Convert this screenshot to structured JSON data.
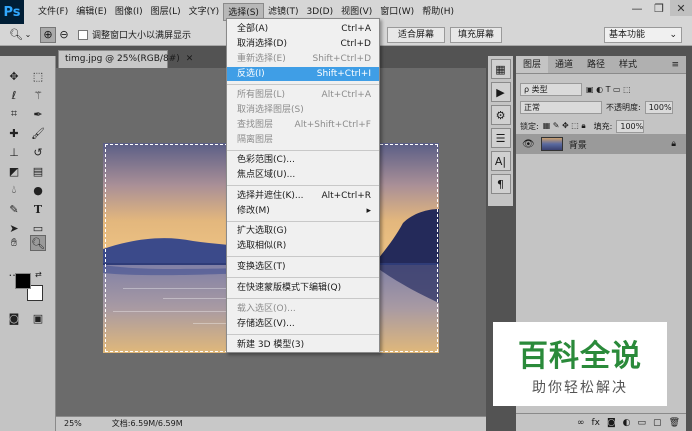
{
  "app_logo": "Ps",
  "menubar": [
    "文件(F)",
    "编辑(E)",
    "图像(I)",
    "图层(L)",
    "文字(Y)",
    "选择(S)",
    "滤镜(T)",
    "3D(D)",
    "视图(V)",
    "窗口(W)",
    "帮助(H)"
  ],
  "options_bar": {
    "checkbox_label": "调整窗口大小以满屏显示",
    "btn_fit": "适合屏幕",
    "btn_fill": "填充屏幕",
    "workspace": "基本功能"
  },
  "document_tab": {
    "title": "timg.jpg @ 25%(RGB/8#)"
  },
  "status_bar": {
    "zoom": "25%",
    "doc": "文档:6.59M/6.59M"
  },
  "select_menu": [
    {
      "label": "全部(A)",
      "shortcut": "Ctrl+A",
      "state": "normal"
    },
    {
      "label": "取消选择(D)",
      "shortcut": "Ctrl+D",
      "state": "normal"
    },
    {
      "label": "重新选择(E)",
      "shortcut": "Shift+Ctrl+D",
      "state": "disabled"
    },
    {
      "label": "反选(I)",
      "shortcut": "Shift+Ctrl+I",
      "state": "highlighted"
    },
    {
      "label": "所有图层(L)",
      "shortcut": "Alt+Ctrl+A",
      "state": "disabled"
    },
    {
      "label": "取消选择图层(S)",
      "shortcut": "",
      "state": "disabled"
    },
    {
      "label": "查找图层",
      "shortcut": "Alt+Shift+Ctrl+F",
      "state": "disabled"
    },
    {
      "label": "隔离图层",
      "shortcut": "",
      "state": "disabled"
    },
    {
      "label": "色彩范围(C)...",
      "shortcut": "",
      "state": "normal"
    },
    {
      "label": "焦点区域(U)...",
      "shortcut": "",
      "state": "normal"
    },
    {
      "label": "选择并遮住(K)...",
      "shortcut": "Alt+Ctrl+R",
      "state": "normal"
    },
    {
      "label": "修改(M)",
      "shortcut": "▸",
      "state": "normal"
    },
    {
      "label": "扩大选取(G)",
      "shortcut": "",
      "state": "normal"
    },
    {
      "label": "选取相似(R)",
      "shortcut": "",
      "state": "normal"
    },
    {
      "label": "变换选区(T)",
      "shortcut": "",
      "state": "normal"
    },
    {
      "label": "在快速蒙版模式下编辑(Q)",
      "shortcut": "",
      "state": "normal"
    },
    {
      "label": "载入选区(O)...",
      "shortcut": "",
      "state": "disabled"
    },
    {
      "label": "存储选区(V)...",
      "shortcut": "",
      "state": "normal"
    },
    {
      "label": "新建 3D 模型(3)",
      "shortcut": "",
      "state": "normal"
    }
  ],
  "layers_panel": {
    "tabs": [
      "图层",
      "通道",
      "路径",
      "样式"
    ],
    "kind_filter": "ρ 类型",
    "blend_mode": "正常",
    "opacity_label": "不透明度:",
    "opacity_value": "100%",
    "lock_label": "锁定:",
    "fill_label": "填充:",
    "fill_value": "100%",
    "layer_name": "背景"
  },
  "watermark": {
    "title": "百科全说",
    "subtitle": "助你轻松解决"
  },
  "colors": {
    "highlight": "#3f9ee6",
    "watermark_green": "#2a8a3a"
  }
}
